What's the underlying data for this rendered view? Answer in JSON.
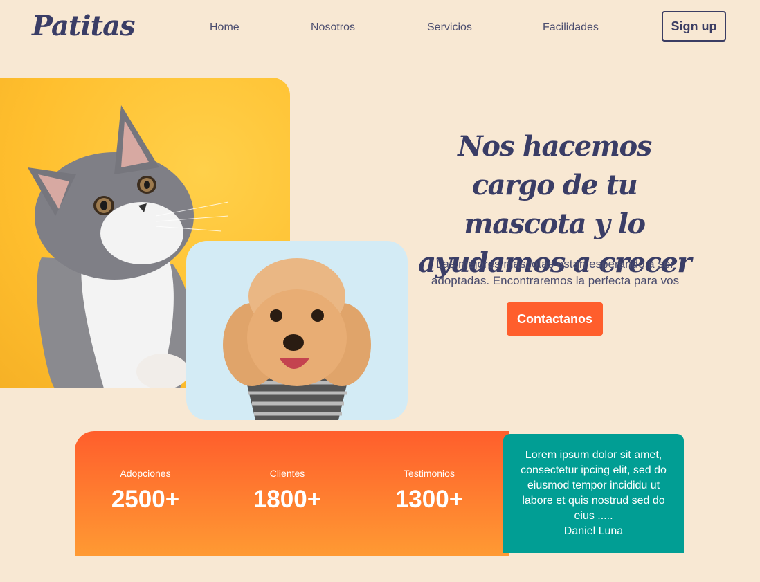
{
  "brand": {
    "logo": "Patitas"
  },
  "nav": {
    "links": [
      "Home",
      "Nosotros",
      "Servicios",
      "Facilidades"
    ],
    "signup_label": "Sign up"
  },
  "hero": {
    "title": "Nos hacemos cargo de tu mascota y lo ayudamos a crecer",
    "subtitle": "Las mejores mascotas estan esperando a ser adoptadas. Encontraremos la perfecta para vos",
    "cta_label": "Contactanos"
  },
  "stats": [
    {
      "label": "Adopciones",
      "value": "2500+"
    },
    {
      "label": "Clientes",
      "value": "1800+"
    },
    {
      "label": "Testimonios",
      "value": "1300+"
    }
  ],
  "testimonial": {
    "text": "Lorem ipsum dolor sit amet, consectetur ipcing elit, sed do eiusmod tempor incididu ut labore et quis nostrud sed do eius .....",
    "author": "Daniel Luna"
  },
  "colors": {
    "background": "#f8e8d3",
    "primary_text": "#3b3d63",
    "accent_orange": "#ff5e2c",
    "stats_gradient_end": "#ff9a33",
    "teal": "#019e94",
    "cat_bg": "#ffc23a",
    "dog_bg": "#d3ebf5"
  },
  "images": {
    "cat": "gray-white-kitten-photo",
    "dog": "poodle-with-scarf-photo"
  }
}
